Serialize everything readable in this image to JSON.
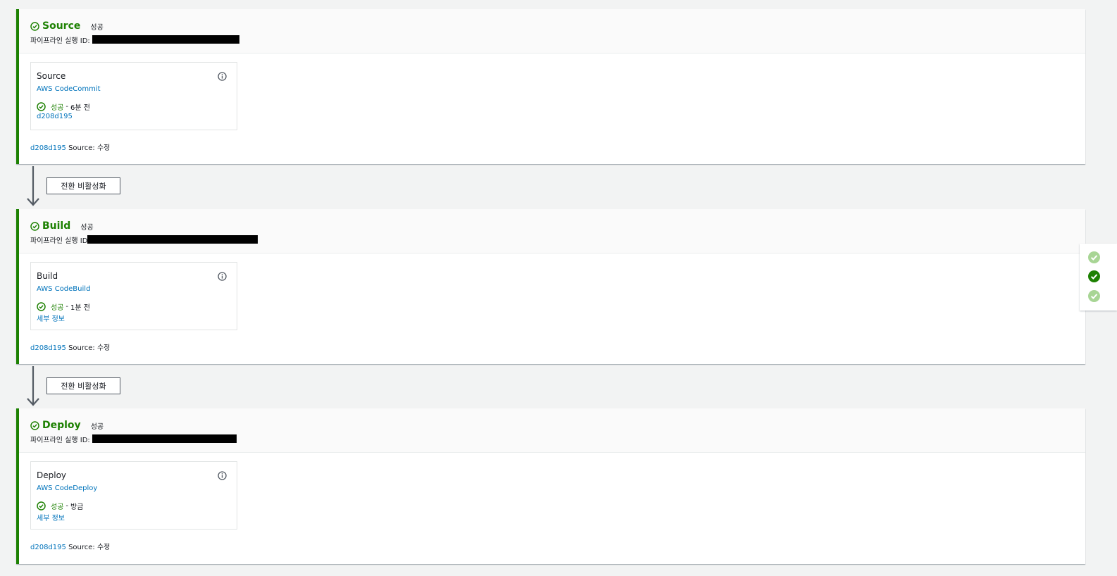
{
  "stages": [
    {
      "name": "Source",
      "status": "성공",
      "exec_label": "파이프라인 실행 ID:",
      "action": {
        "name": "Source",
        "provider": "AWS CodeCommit",
        "status": "성공",
        "separator": "-",
        "time": "6분 전",
        "detail": "d208d195"
      },
      "revision": {
        "id": "d208d195",
        "text": "Source: 수정"
      }
    },
    {
      "name": "Build",
      "status": "성공",
      "exec_label": "파이프라인 실행 ID",
      "action": {
        "name": "Build",
        "provider": "AWS CodeBuild",
        "status": "성공",
        "separator": "-",
        "time": "1분 전",
        "detail": "세부 정보"
      },
      "revision": {
        "id": "d208d195",
        "text": "Source: 수정"
      }
    },
    {
      "name": "Deploy",
      "status": "성공",
      "exec_label": "파이프라인 실행 ID:",
      "action": {
        "name": "Deploy",
        "provider": "AWS CodeDeploy",
        "status": "성공",
        "separator": "-",
        "time": "방금",
        "detail": "세부 정보"
      },
      "revision": {
        "id": "d208d195",
        "text": "Source: 수정"
      }
    }
  ],
  "transitions": [
    {
      "button_label": "전환 비활성화"
    },
    {
      "button_label": "전환 비활성화"
    }
  ],
  "icons": {
    "stage_status": "check-circle-icon",
    "action_info": "info-icon",
    "transition": "arrow-down-icon",
    "nav": "check-filled-icon"
  },
  "colors": {
    "success": "#1d8102",
    "link": "#0073bb",
    "nav_inactive": "#a8d595",
    "nav_active": "#1d8102"
  }
}
